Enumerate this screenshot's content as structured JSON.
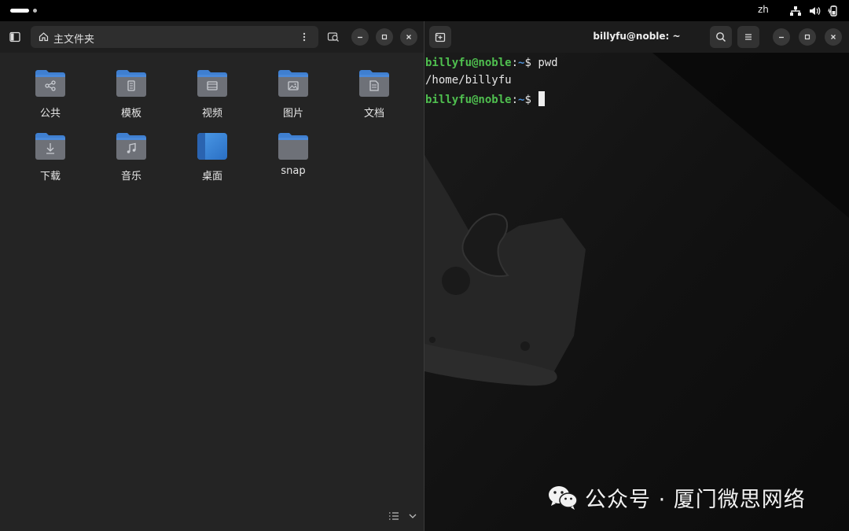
{
  "topbar": {
    "language": "zh",
    "icons": [
      "network-icon",
      "volume-icon",
      "battery-icon"
    ]
  },
  "files": {
    "path_label": "主文件夹",
    "items": [
      {
        "label": "公共",
        "icon": "share-icon"
      },
      {
        "label": "模板",
        "icon": "template-icon"
      },
      {
        "label": "视频",
        "icon": "film-icon"
      },
      {
        "label": "图片",
        "icon": "image-icon"
      },
      {
        "label": "文档",
        "icon": "document-icon"
      },
      {
        "label": "下载",
        "icon": "download-icon"
      },
      {
        "label": "音乐",
        "icon": "music-icon"
      },
      {
        "label": "桌面",
        "icon": "desktop-icon"
      },
      {
        "label": "snap",
        "icon": "folder-icon"
      }
    ]
  },
  "terminal": {
    "title": "billyfu@noble: ~",
    "lines": [
      {
        "user": "billyfu@noble",
        "sep": ":",
        "path": "~",
        "prompt": "$ ",
        "cmd": "pwd"
      },
      {
        "output": "/home/billyfu"
      },
      {
        "user": "billyfu@noble",
        "sep": ":",
        "path": "~",
        "prompt": "$ ",
        "cmd": ""
      }
    ]
  },
  "watermark": {
    "text": "公众号 · 厦门微思网络"
  },
  "colors": {
    "folder_blue": "#3f7fd0",
    "folder_body": "#6e7178",
    "prompt_user": "#4fbf4f",
    "prompt_path": "#4e8fd6"
  }
}
